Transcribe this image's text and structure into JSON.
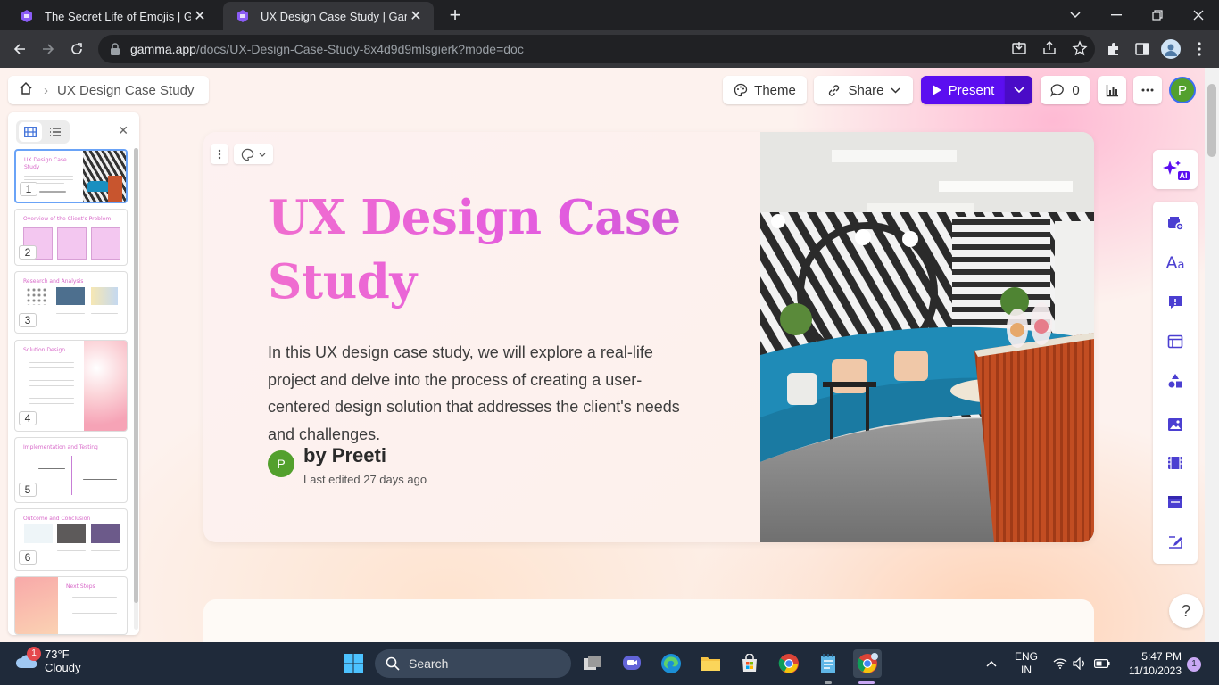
{
  "browser": {
    "tabs": [
      {
        "title": "The Secret Life of Emojis | Gamma",
        "active": false
      },
      {
        "title": "UX Design Case Study | Gamma",
        "active": true
      }
    ],
    "url_host": "gamma.app",
    "url_path": "/docs/UX-Design-Case-Study-8x4d9d9mlsgierk?mode=doc"
  },
  "header": {
    "breadcrumb_title": "UX Design Case Study",
    "theme_label": "Theme",
    "share_label": "Share",
    "present_label": "Present",
    "comments_count": "0",
    "avatar_initial": "P"
  },
  "sidebar": {
    "slides": [
      {
        "number": "1",
        "title": "UX Design Case Study"
      },
      {
        "number": "2",
        "title": "Overview of the Client's Problem"
      },
      {
        "number": "3",
        "title": "Research and Analysis"
      },
      {
        "number": "4",
        "title": "Solution Design"
      },
      {
        "number": "5",
        "title": "Implementation and Testing"
      },
      {
        "number": "6",
        "title": "Outcome and Conclusion"
      },
      {
        "number": "",
        "title": "Next Steps"
      }
    ]
  },
  "card": {
    "title": "UX Design Case Study",
    "description": "In this UX design case study, we will explore a real-life project and delve into the process of creating a user-centered design solution that addresses the client's needs and challenges.",
    "author_initial": "P",
    "author": "by Preeti",
    "meta": "Last edited 27 days ago"
  },
  "rail": {
    "ai_label": "AI",
    "help_label": "?"
  },
  "taskbar": {
    "temperature": "73°F",
    "condition": "Cloudy",
    "weather_badge": "1",
    "search_placeholder": "Search",
    "lang_top": "ENG",
    "lang_bottom": "IN",
    "time": "5:47 PM",
    "date": "11/10/2023",
    "notification_count": "1"
  },
  "colors": {
    "accent": "#5b0ef0",
    "title_gradient_start": "#f06ecf",
    "avatar": "#53a02d"
  }
}
